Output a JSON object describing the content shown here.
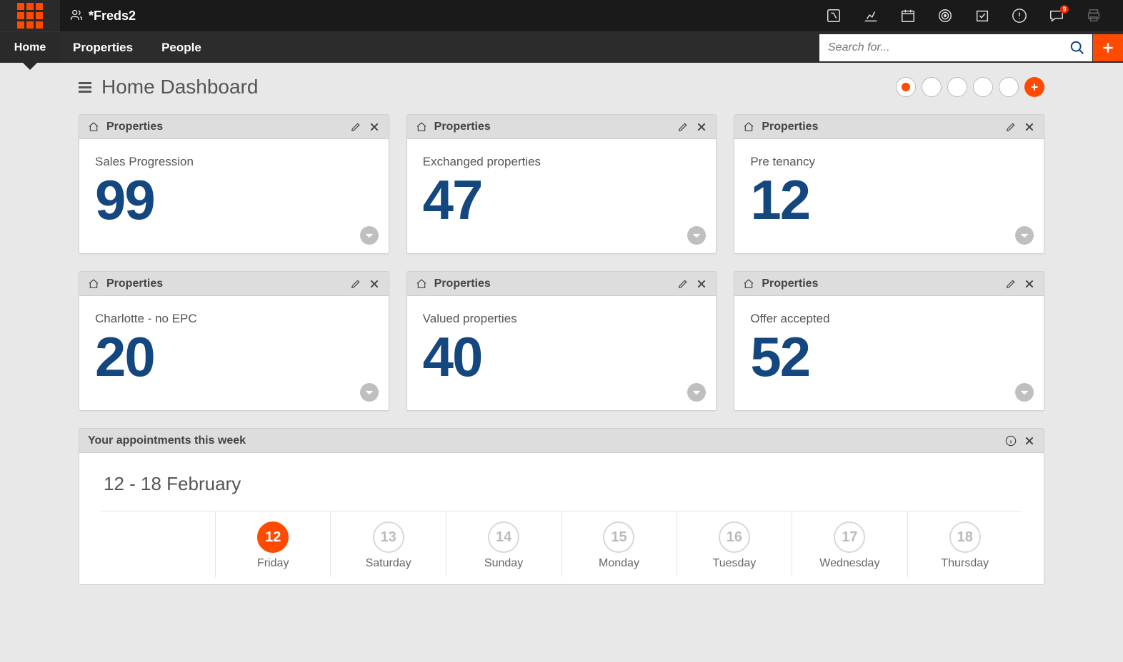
{
  "topbar": {
    "team_name": "*Freds2",
    "notification_count": "9"
  },
  "nav": {
    "home": "Home",
    "properties": "Properties",
    "people": "People",
    "search_placeholder": "Search for..."
  },
  "page": {
    "title": "Home Dashboard"
  },
  "widgets": [
    {
      "header": "Properties",
      "label": "Sales Progression",
      "value": "99"
    },
    {
      "header": "Properties",
      "label": "Exchanged properties",
      "value": "47"
    },
    {
      "header": "Properties",
      "label": "Pre tenancy",
      "value": "12"
    },
    {
      "header": "Properties",
      "label": "Charlotte - no EPC",
      "value": "20"
    },
    {
      "header": "Properties",
      "label": "Valued properties",
      "value": "40"
    },
    {
      "header": "Properties",
      "label": "Offer accepted",
      "value": "52"
    }
  ],
  "appointments": {
    "title": "Your appointments this week",
    "range": "12 - 18 February",
    "days": [
      {
        "num": "12",
        "name": "Friday",
        "today": true
      },
      {
        "num": "13",
        "name": "Saturday",
        "today": false
      },
      {
        "num": "14",
        "name": "Sunday",
        "today": false
      },
      {
        "num": "15",
        "name": "Monday",
        "today": false
      },
      {
        "num": "16",
        "name": "Tuesday",
        "today": false
      },
      {
        "num": "17",
        "name": "Wednesday",
        "today": false
      },
      {
        "num": "18",
        "name": "Thursday",
        "today": false
      }
    ]
  }
}
